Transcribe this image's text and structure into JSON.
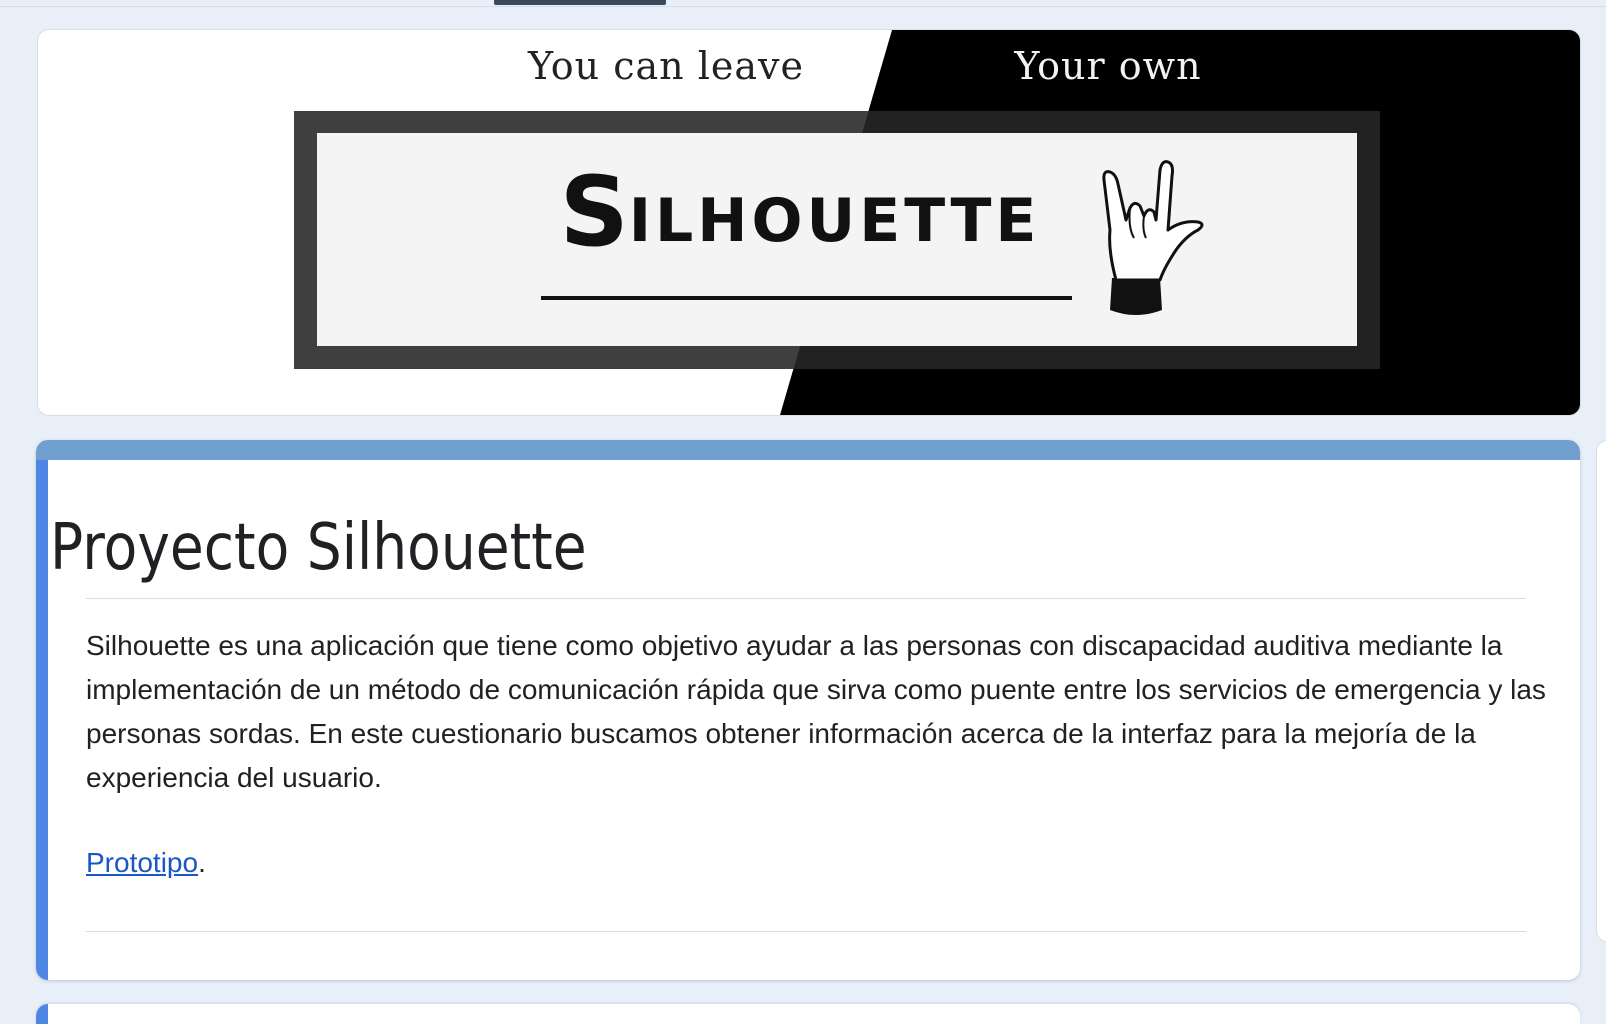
{
  "banner": {
    "left_tagline": "You can leave",
    "right_tagline": "Your own",
    "logo_initial": "S",
    "logo_rest": "ILHOUETTE",
    "logo_icon": "hand-sign-icon"
  },
  "form": {
    "title": "Proyecto Silhouette",
    "description": "Silhouette es una aplicación que tiene como objetivo ayudar a las personas con discapacidad auditiva mediante la implementación de un método de comunicación rápida que sirva como puente entre los servicios de emergencia y las personas sordas. En este cuestionario buscamos obtener información acerca de la interfaz para la mejoría de la experiencia del usuario.",
    "link_text": "Prototipo",
    "link_suffix": "."
  },
  "colors": {
    "page_background": "#e8eff8",
    "card_accent_top": "#6f9ecf",
    "card_accent_left": "#4f86e4",
    "link": "#1a56c8"
  }
}
